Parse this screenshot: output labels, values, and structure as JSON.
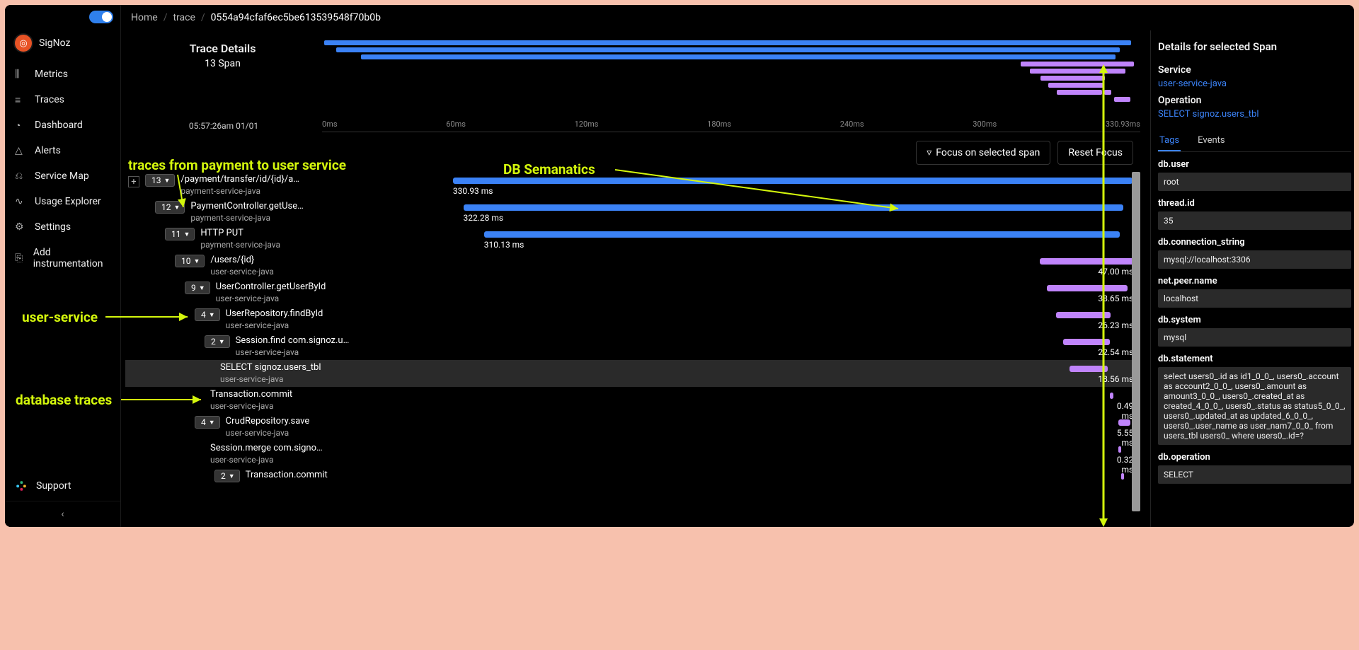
{
  "app": {
    "name": "SigNoz"
  },
  "nav": {
    "items": [
      {
        "icon": "bar-chart-icon",
        "label": "Metrics"
      },
      {
        "icon": "menu-icon",
        "label": "Traces"
      },
      {
        "icon": "gauge-icon",
        "label": "Dashboard"
      },
      {
        "icon": "bell-icon",
        "label": "Alerts"
      },
      {
        "icon": "nodes-icon",
        "label": "Service Map"
      },
      {
        "icon": "line-chart-icon",
        "label": "Usage Explorer"
      },
      {
        "icon": "gear-icon",
        "label": "Settings"
      },
      {
        "icon": "link-icon",
        "label": "Add instrumentation"
      }
    ],
    "support": "Support"
  },
  "breadcrumb": {
    "home": "Home",
    "trace": "trace",
    "id": "0554a94cfaf6ec5be613539548f70b0b"
  },
  "traceHeader": {
    "title": "Trace Details",
    "spanCount": "13 Span",
    "timestamp": "05:57:26am 01/01"
  },
  "timeTicks": [
    "0ms",
    "60ms",
    "120ms",
    "180ms",
    "240ms",
    "300ms",
    "330.93ms"
  ],
  "toolbar": {
    "focus": "Focus on selected span",
    "reset": "Reset Focus"
  },
  "spans": [
    {
      "depth": 0,
      "count": "13",
      "name": "/payment/transfer/id/{id}/a…",
      "svc": "payment-service-java",
      "color": "blue",
      "leftPct": 0.5,
      "widthPct": 98.4,
      "dur": "330.93 ms",
      "durSide": "left"
    },
    {
      "depth": 1,
      "count": "12",
      "name": "PaymentController.getUse…",
      "svc": "payment-service-java",
      "color": "blue",
      "leftPct": 2.0,
      "widthPct": 95.5,
      "dur": "322.28 ms",
      "durSide": "left"
    },
    {
      "depth": 2,
      "count": "11",
      "name": "HTTP PUT",
      "svc": "payment-service-java",
      "color": "blue",
      "leftPct": 5.0,
      "widthPct": 92.0,
      "dur": "310.13 ms",
      "durSide": "left"
    },
    {
      "depth": 3,
      "count": "10",
      "name": "/users/{id}",
      "svc": "user-service-java",
      "color": "purple",
      "leftPct": 85.4,
      "widthPct": 13.8,
      "dur": "47.00 ms",
      "durSide": "right"
    },
    {
      "depth": 4,
      "count": "9",
      "name": "UserController.getUserById",
      "svc": "user-service-java",
      "color": "purple",
      "leftPct": 86.5,
      "widthPct": 11.7,
      "dur": "38.65 ms",
      "durSide": "right"
    },
    {
      "depth": 5,
      "count": "4",
      "name": "UserRepository.findById",
      "svc": "user-service-java",
      "color": "purple",
      "leftPct": 87.8,
      "widthPct": 7.9,
      "dur": "26.23 ms",
      "durSide": "right"
    },
    {
      "depth": 6,
      "count": "2",
      "name": "Session.find com.signoz.u…",
      "svc": "user-service-java",
      "color": "purple",
      "leftPct": 88.8,
      "widthPct": 6.8,
      "dur": "22.54 ms",
      "durSide": "right"
    },
    {
      "depth": 7,
      "count": "",
      "name": "SELECT signoz.users_tbl",
      "svc": "user-service-java",
      "color": "purple",
      "leftPct": 89.8,
      "widthPct": 5.5,
      "dur": "18.56 ms",
      "durSide": "right",
      "selected": true
    },
    {
      "depth": 6,
      "count": "",
      "name": "Transaction.commit",
      "svc": "user-service-java",
      "color": "purple",
      "leftPct": 95.6,
      "widthPct": 0.5,
      "dur": "0.49 ms",
      "durSide": "right",
      "stack": true
    },
    {
      "depth": 5,
      "count": "4",
      "name": "CrudRepository.save",
      "svc": "user-service-java",
      "color": "purple",
      "leftPct": 96.8,
      "widthPct": 1.8,
      "dur": "5.55 ms",
      "durSide": "right",
      "stack": true
    },
    {
      "depth": 6,
      "count": "",
      "name": "Session.merge com.signo…",
      "svc": "user-service-java",
      "color": "purple",
      "leftPct": 96.8,
      "widthPct": 0.4,
      "dur": "0.32 ms",
      "durSide": "right",
      "stack": true
    },
    {
      "depth": 7,
      "count": "2",
      "name": "Transaction.commit",
      "svc": "",
      "color": "purple",
      "leftPct": 97.2,
      "widthPct": 0.4,
      "dur": "",
      "durSide": "right"
    }
  ],
  "details": {
    "header": "Details for selected Span",
    "serviceLabel": "Service",
    "service": "user-service-java",
    "opLabel": "Operation",
    "operation": "SELECT signoz.users_tbl",
    "tabs": {
      "tags": "Tags",
      "events": "Events"
    },
    "tags": [
      {
        "k": "db.user",
        "v": "root"
      },
      {
        "k": "thread.id",
        "v": "35"
      },
      {
        "k": "db.connection_string",
        "v": "mysql://localhost:3306"
      },
      {
        "k": "net.peer.name",
        "v": "localhost"
      },
      {
        "k": "db.system",
        "v": "mysql"
      },
      {
        "k": "db.statement",
        "v": "select users0_.id as id1_0_0_, users0_.account as account2_0_0_, users0_.amount as amount3_0_0_, users0_.created_at as created_4_0_0_, users0_.status as status5_0_0_, users0_.updated_at as updated_6_0_0_, users0_.user_name as user_nam7_0_0_ from users_tbl users0_ where users0_.id=?"
      },
      {
        "k": "db.operation",
        "v": "SELECT"
      }
    ]
  },
  "annotations": {
    "a1": "traces from payment to user service",
    "a2": "DB Semanatics",
    "a3": "user-service",
    "a4": "database traces"
  }
}
